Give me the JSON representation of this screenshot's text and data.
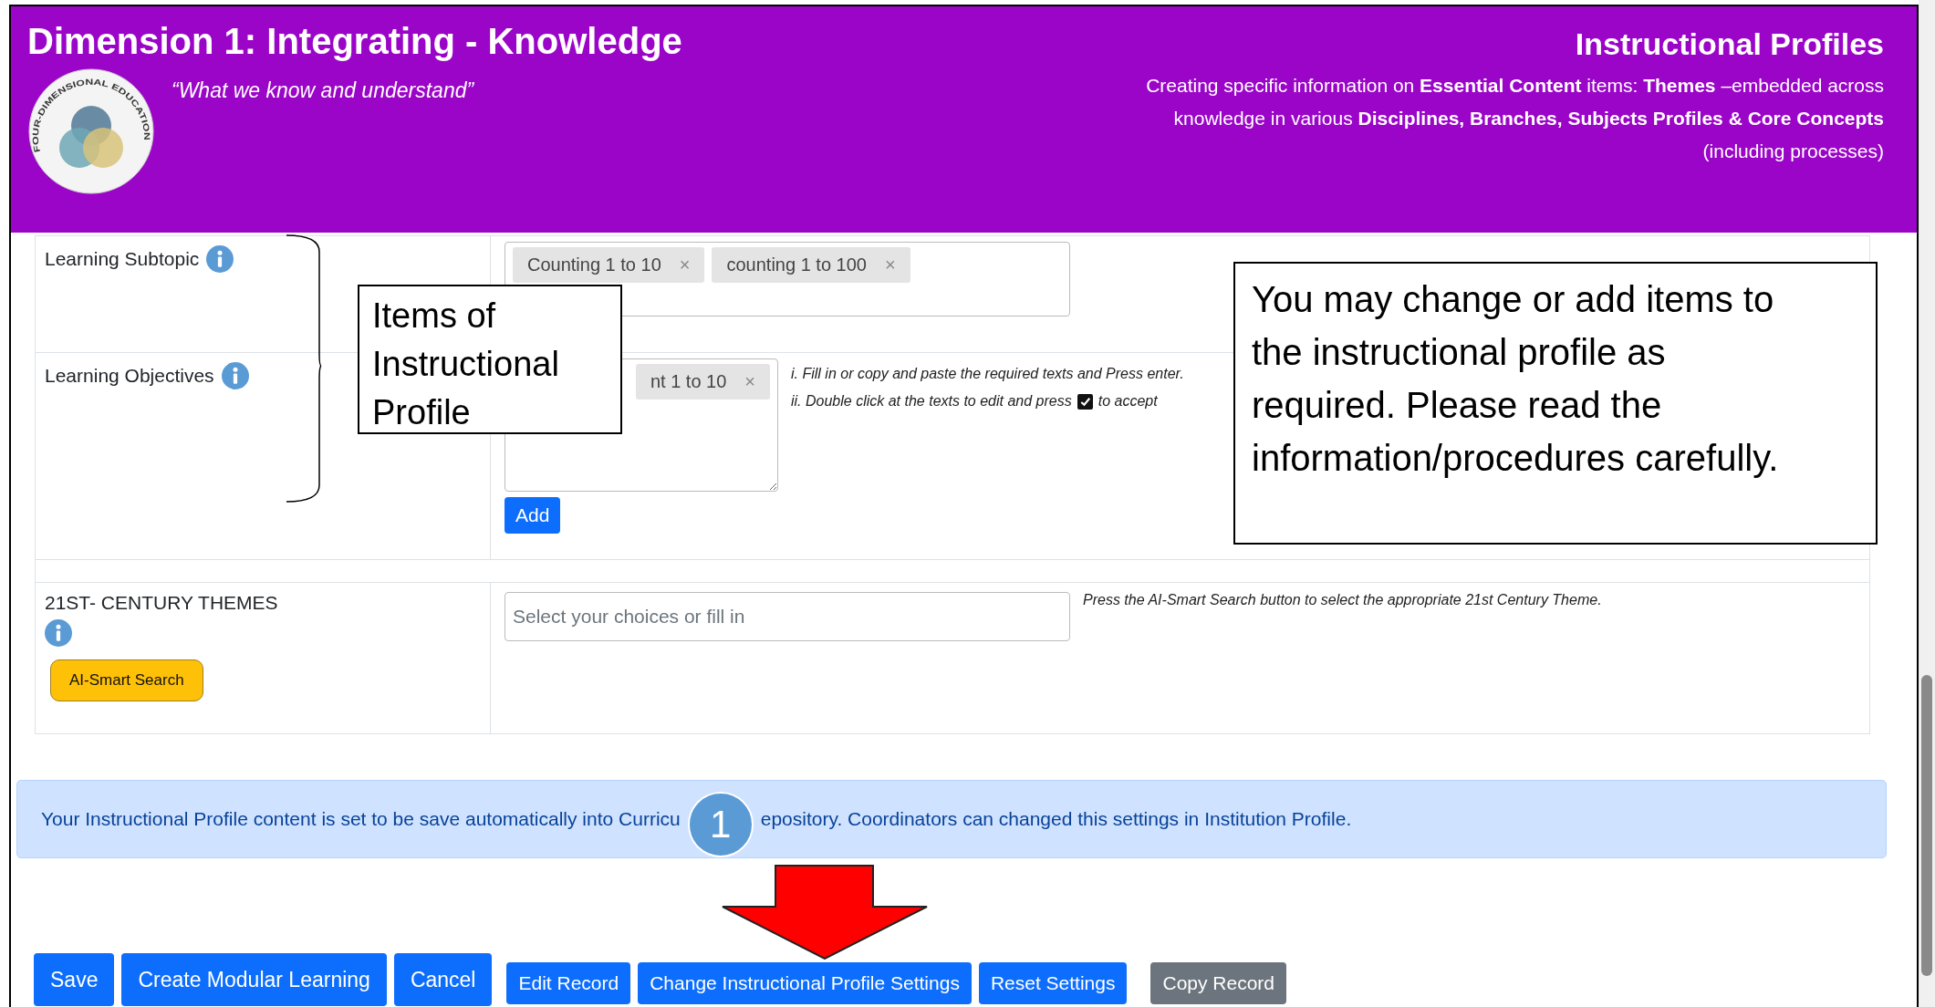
{
  "header": {
    "title": "Dimension 1: Integrating - Knowledge",
    "quote": "“What we know and understand”",
    "logo_text": "FOUR-DIMENSIONAL EDUCATION",
    "right_title": "Instructional Profiles",
    "description_lines": [
      "Creating specific information on **Essential Content** items: **Themes** –embedded across",
      "knowledge in various **Disciplines, Branches, Subjects Profiles & Core Concepts**",
      "(including processes)"
    ]
  },
  "form": {
    "rows": [
      {
        "kind": "tags",
        "label": "Learning Subtopic",
        "tags": [
          {
            "label": "Counting 1 to 10",
            "remove": "×"
          },
          {
            "label": "counting 1 to 100",
            "remove": "×"
          }
        ]
      },
      {
        "kind": "textarea_tags",
        "label": "Learning Objectives",
        "tags": [
          {
            "label": "nt 1 to 10",
            "remove": "×"
          }
        ],
        "button": "Add",
        "hints": [
          {
            "before": "i. Fill in or copy and paste the required texts and Press enter."
          },
          {
            "before": "ii. Double click at the texts to edit and press",
            "after": "to accept"
          }
        ]
      },
      {
        "kind": "gap"
      },
      {
        "kind": "search",
        "label": "21ST- CENTURY THEMES",
        "placeholder": "Select your choices or fill in",
        "hint": "Press the AI-Smart Search button to select the appropriate 21st Century Theme.",
        "button": "AI-Smart Search"
      }
    ]
  },
  "alert": {
    "text_before": "Your Instructional Profile content is set to be save automatically into Curricu",
    "text_after": "epository. Coordinators can changed this settings in Institution Profile."
  },
  "buttons": [
    {
      "label": "Save",
      "kind": "large"
    },
    {
      "label": "Create Modular Learning",
      "kind": "large"
    },
    {
      "label": "Cancel",
      "kind": "large"
    },
    {
      "label": "Edit Record",
      "kind": "small"
    },
    {
      "label": "Change Instructional Profile Settings",
      "kind": "small"
    },
    {
      "label": "Reset Settings",
      "kind": "small"
    },
    {
      "label": "Copy Record",
      "kind": "secondary"
    }
  ],
  "annotations": {
    "callouts": [
      {
        "kind": "items",
        "text": "Items of Instructional Profile"
      },
      {
        "kind": "note",
        "text": "You may change or add items to the instructional profile as required. Please read the information/procedures carefully."
      }
    ],
    "step_marker": "1"
  }
}
